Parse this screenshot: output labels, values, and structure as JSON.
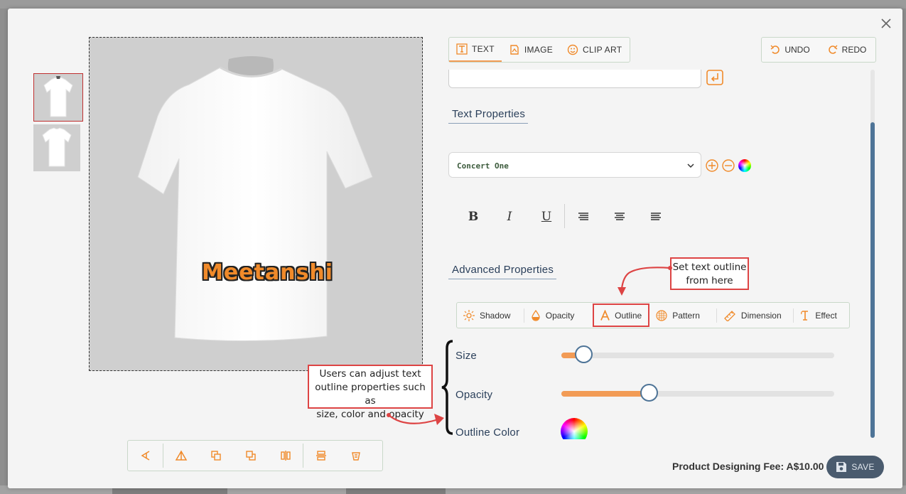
{
  "canvas": {
    "design_text": "Meetanshi"
  },
  "tabs": [
    {
      "label": "TEXT",
      "icon": "text-icon",
      "active": true
    },
    {
      "label": "IMAGE",
      "icon": "image-icon"
    },
    {
      "label": "CLIP ART",
      "icon": "clipart-icon"
    }
  ],
  "history": {
    "undo_label": "UNDO",
    "redo_label": "REDO"
  },
  "text_properties": {
    "title": "Text Properties",
    "font_value": "Concert One"
  },
  "advanced_properties": {
    "title": "Advanced Properties",
    "tabs": [
      "Shadow",
      "Opacity",
      "Outline",
      "Pattern",
      "Dimension",
      "Effect"
    ],
    "selected_tab": "Outline"
  },
  "outline": {
    "size_label": "Size",
    "size_value": 0.08,
    "opacity_label": "Opacity",
    "opacity_value": 0.32,
    "color_label": "Outline Color"
  },
  "callouts": {
    "outline_tip": "Set text outline from here",
    "outline_tip_line1": "Set text outline",
    "outline_tip_line2": "from here",
    "adjust_tip": "Users can adjust text outline properties such as size, color and opacity",
    "adjust_tip_line1": "Users can adjust text",
    "adjust_tip_line2": "outline properties such as",
    "adjust_tip_line3": "size, color and opacity"
  },
  "footer": {
    "fee_text": "Product Designing Fee: A$10.00",
    "save_label": "SAVE"
  },
  "colors": {
    "accent": "#f29b55",
    "primary": "#4e7497",
    "highlight": "#dd4444"
  }
}
